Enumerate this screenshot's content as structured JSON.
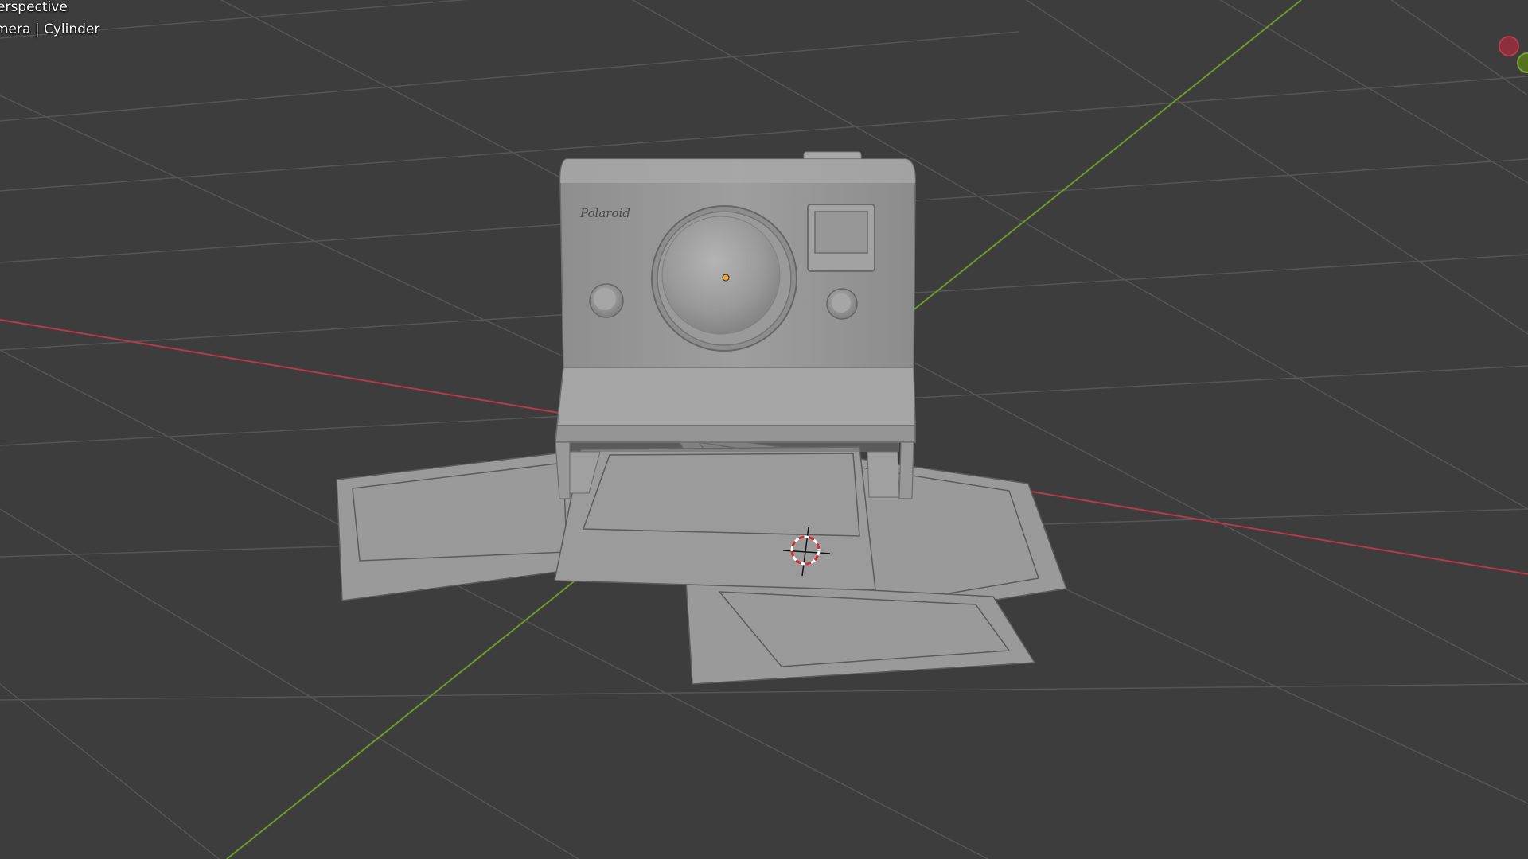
{
  "viewport": {
    "view_mode": "erspective",
    "collection_label": "mera | Cylinder",
    "background_color": "#3d3d3d",
    "grid_color": "#555555",
    "x_axis_color": "#b8394a",
    "y_axis_color": "#6a9a2c"
  },
  "model": {
    "brand_text": "Polaroid",
    "object_color": "#9c9c9c"
  },
  "gizmo": {
    "x_axis_color": "#b43b4d",
    "y_axis_color": "#7ba238"
  },
  "icons": {
    "cursor": "3d-cursor-icon",
    "origin": "object-origin-icon",
    "gizmo": "navigation-gizmo-icon"
  }
}
